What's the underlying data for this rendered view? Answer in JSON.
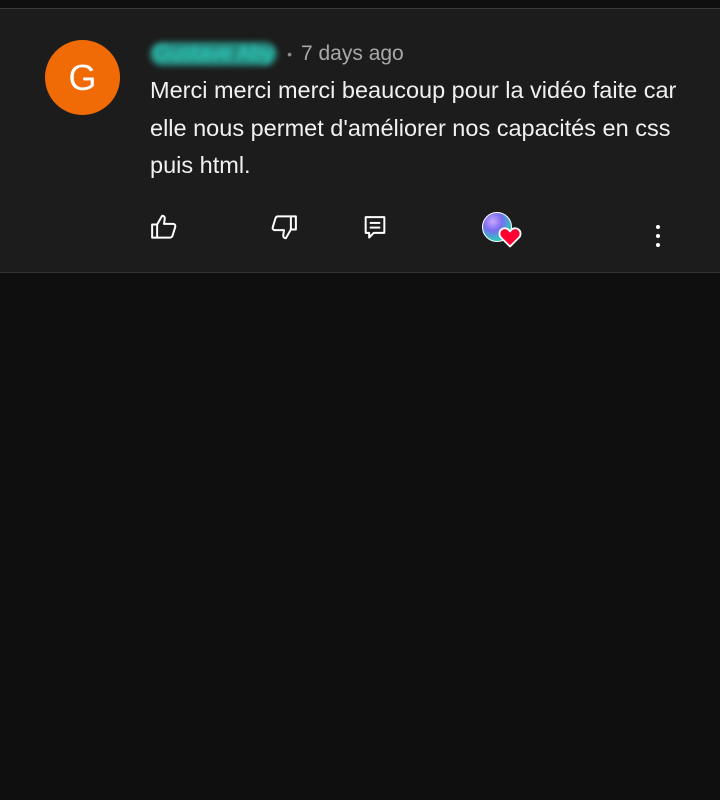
{
  "comment": {
    "avatar_initial": "G",
    "author": "Gustave Aby",
    "separator": "•",
    "time_ago": "7 days ago",
    "text": "Merci merci merci beaucoup pour la vidéo faite car elle nous permet d'améliorer nos capacités en css puis html."
  },
  "actions": {
    "like_icon": "thumb-up-icon",
    "dislike_icon": "thumb-down-icon",
    "reply_icon": "reply-icon",
    "creator_heart_icon": "creator-heart-icon",
    "more_icon": "more-vert-icon"
  },
  "colors": {
    "background": "#0f0f0f",
    "card": "#1c1c1c",
    "avatar": "#f06b06",
    "author_highlight": "#2fe3cf",
    "heart": "#ff0033"
  }
}
